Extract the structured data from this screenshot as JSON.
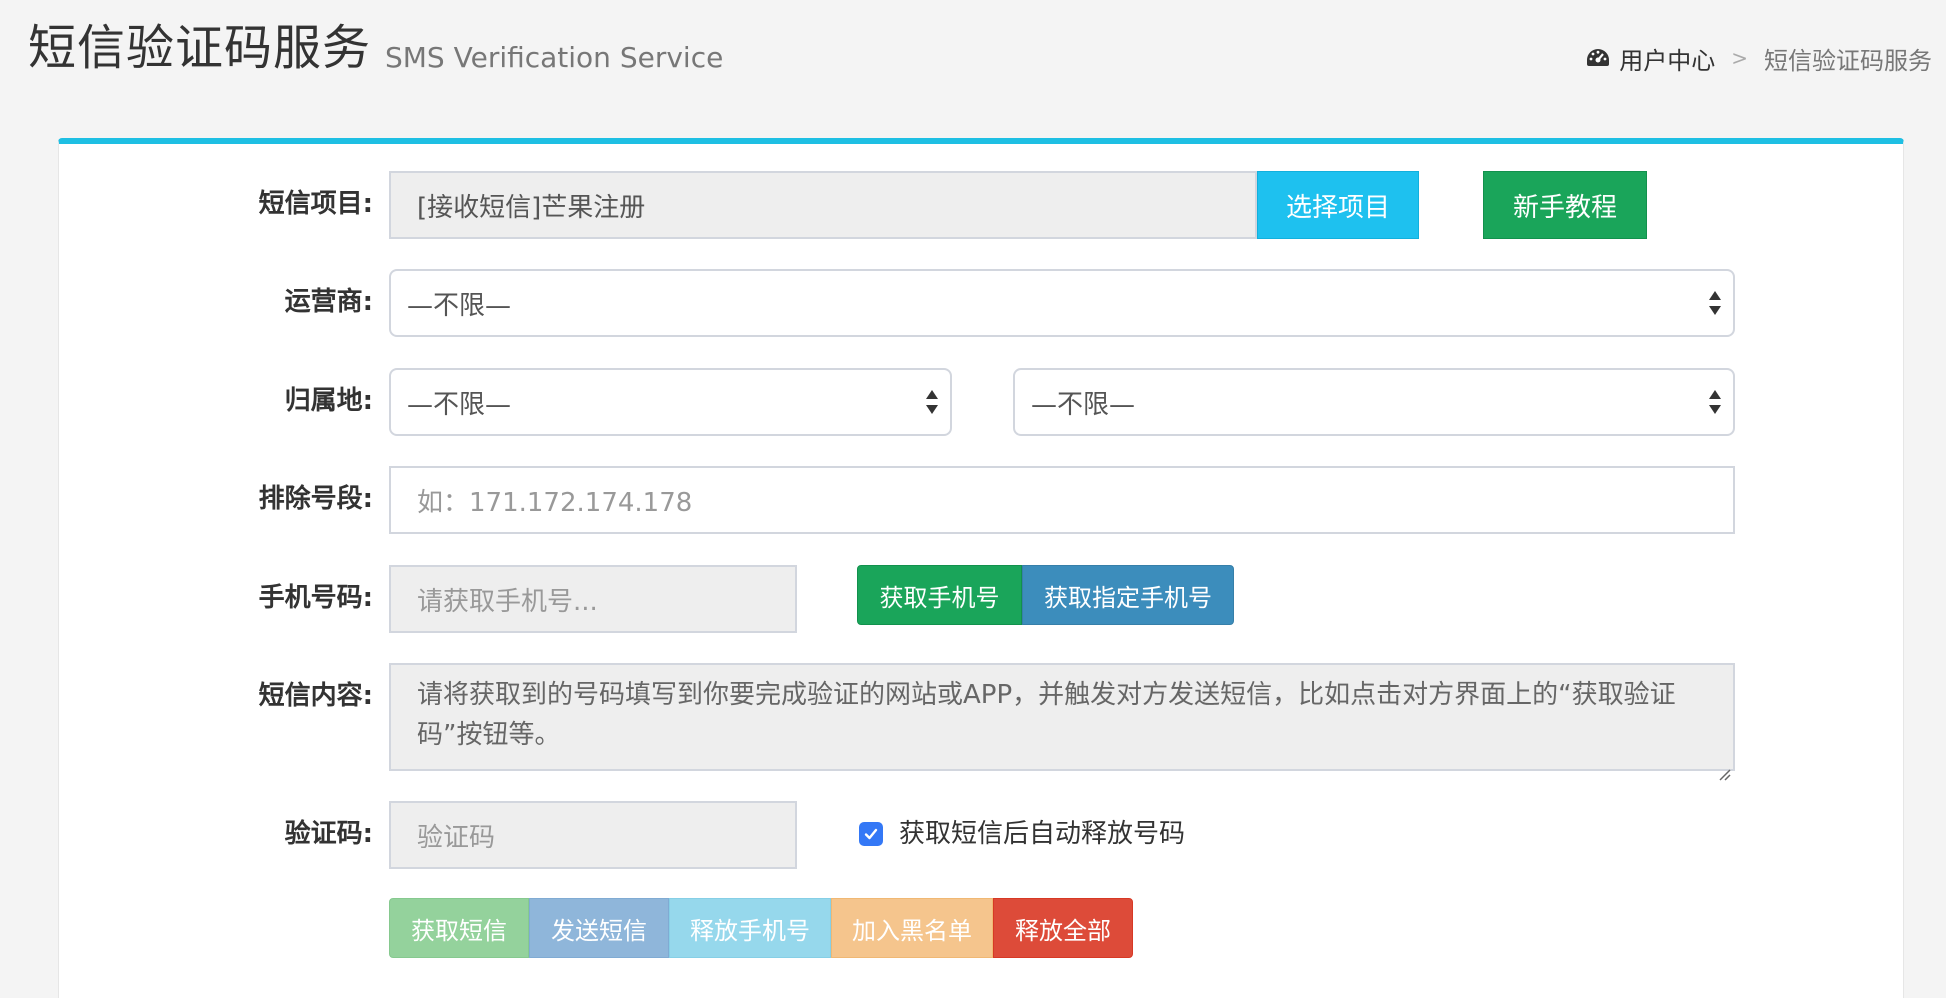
{
  "header": {
    "title": "短信验证码服务",
    "subtitle": "SMS Verification Service",
    "breadcrumb": {
      "home_icon": "dashboard-icon",
      "home": "用户中心",
      "separator": ">",
      "current": "短信验证码服务"
    }
  },
  "colors": {
    "accent": "#1ebfe3",
    "info": "#1ec1ef",
    "success": "#1aa55a",
    "primary": "#3c8dbc",
    "danger": "#dd4b39",
    "warning": "#f39c12"
  },
  "form": {
    "project": {
      "label": "短信项目:",
      "value": "[接收短信]芒果注册",
      "select_button": "选择项目",
      "tutorial_button": "新手教程"
    },
    "carrier": {
      "label": "运营商:",
      "selected": "—不限—"
    },
    "location": {
      "label": "归属地:",
      "province_selected": "—不限—",
      "city_selected": "—不限—"
    },
    "exclude": {
      "label": "排除号段:",
      "placeholder": "如：171.172.174.178"
    },
    "phone": {
      "label": "手机号码:",
      "placeholder": "请获取手机号...",
      "get_button": "获取手机号",
      "get_specific_button": "获取指定手机号"
    },
    "content": {
      "label": "短信内容:",
      "text": "请将获取到的号码填写到你要完成验证的网站或APP，并触发对方发送短信，比如点击对方界面上的“获取验证码”按钮等。"
    },
    "code": {
      "label": "验证码:",
      "placeholder": "验证码",
      "auto_release_label": "获取短信后自动释放号码",
      "auto_release_checked": true
    }
  },
  "actions": {
    "get_sms": "获取短信",
    "send_sms": "发送短信",
    "release_phone": "释放手机号",
    "blacklist": "加入黑名单",
    "release_all": "释放全部"
  }
}
